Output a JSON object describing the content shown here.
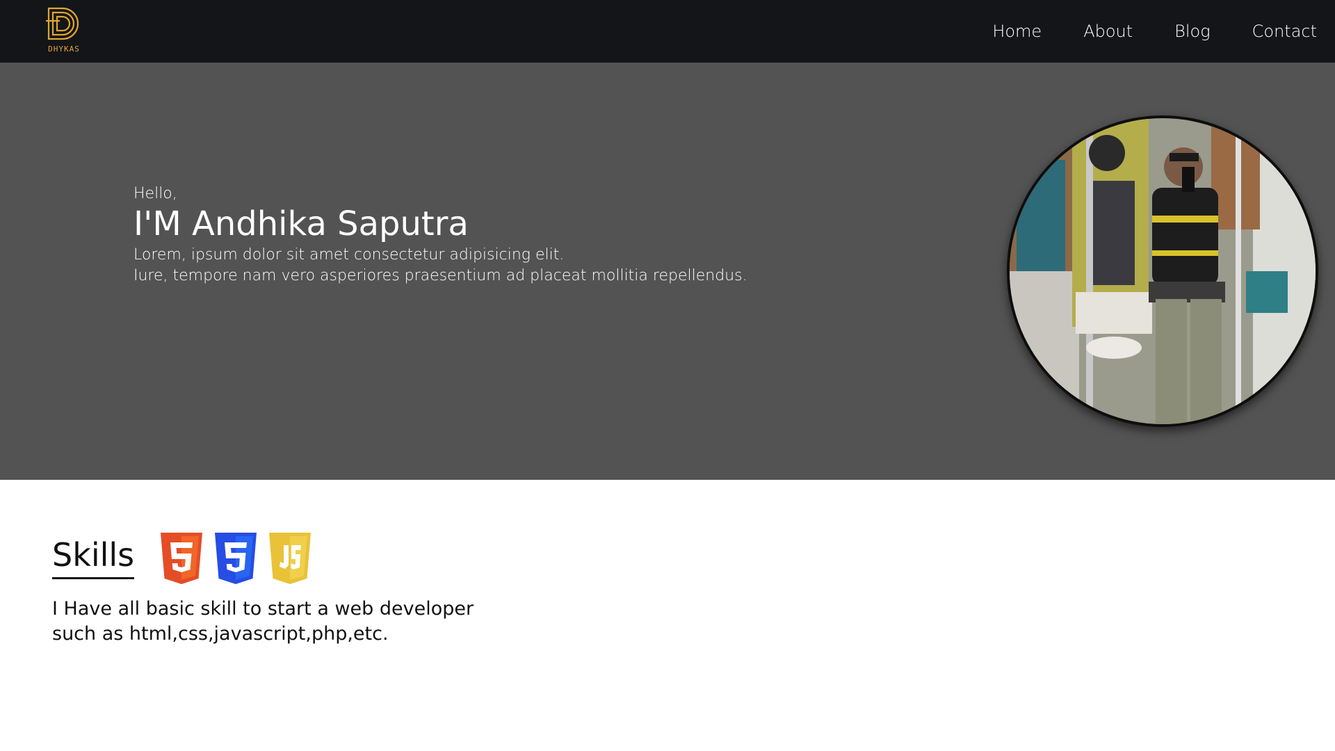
{
  "brand": {
    "name": "DHYKAS",
    "color": "#e0a630"
  },
  "nav": {
    "items": [
      {
        "label": "Home"
      },
      {
        "label": "About"
      },
      {
        "label": "Blog"
      },
      {
        "label": "Contact"
      }
    ]
  },
  "hero": {
    "greeting": "Hello,",
    "name": "I'M Andhika Saputra",
    "desc_line1": "Lorem, ipsum dolor sit amet consectetur adipisicing elit.",
    "desc_line2": "Iure, tempore nam vero asperiores praesentium ad placeat mollitia repellendus.",
    "background": "#535353"
  },
  "skills": {
    "title": "Skills",
    "icons": [
      "html5-icon",
      "css3-icon",
      "js-icon"
    ],
    "desc_line1": "I Have all basic skill to start a web developer",
    "desc_line2": "such as html,css,javascript,php,etc."
  },
  "colors": {
    "navbar": "#141518",
    "html5": "#e44d26",
    "css3": "#264de4",
    "js": "#e9c238"
  }
}
